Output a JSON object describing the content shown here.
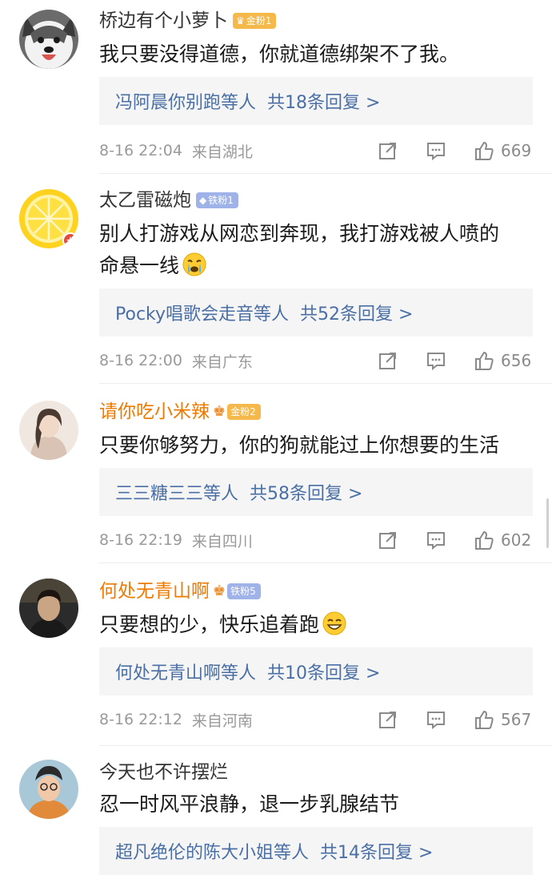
{
  "comments": [
    {
      "username": "桥边有个小萝卜",
      "badge": "金粉1",
      "text_lines": [
        "我只要没得道德，你就道德绑架不了我。"
      ],
      "reply_label": "冯阿晨你别跑等人",
      "reply_count": "共18条回复 >",
      "date": "8-16 22:04",
      "location": "来自湖北",
      "likes": "669"
    },
    {
      "username": "太乙雷磁炮",
      "badge": "铁粉1",
      "text_lines": [
        "别人打游戏从网恋到奔现，我打游戏被人喷的",
        "命悬一线"
      ],
      "reply_label": "Pocky唱歌会走音等人",
      "reply_count": "共52条回复 >",
      "date": "8-16 22:00",
      "location": "来自广东",
      "likes": "656"
    },
    {
      "username": "请你吃小米辣",
      "badge": "金粉2",
      "text_lines": [
        "只要你够努力，你的狗就能过上你想要的生活"
      ],
      "reply_label": "三三糖三三等人",
      "reply_count": "共58条回复 >",
      "date": "8-16 22:19",
      "location": "来自四川",
      "likes": "602"
    },
    {
      "username": "何处无青山啊",
      "badge": "铁粉5",
      "text_lines": [
        "只要想的少，快乐追着跑"
      ],
      "reply_label": "何处无青山啊等人",
      "reply_count": "共10条回复 >",
      "date": "8-16 22:12",
      "location": "来自河南",
      "likes": "567"
    },
    {
      "username": "今天也不许摆烂",
      "text_lines": [
        "忍一时风平浪静，退一步乳腺结节"
      ],
      "reply_label": "超凡绝伦的陈大小姐等人",
      "reply_count": "共14条回复 >"
    }
  ],
  "icons": {
    "share": "share-icon",
    "comment": "comment-icon",
    "like": "thumbs-up-icon",
    "badge_diamond": "diamond-icon",
    "crown": "crown-icon"
  },
  "colors": {
    "reply_link": "#4a6fa5",
    "orange_name": "#ee7a00",
    "gold_badge": "#f5b84a",
    "iron_badge": "#9fb3e8",
    "meta_gray": "#9a9a9a",
    "reply_bg": "#f5f5f5"
  }
}
